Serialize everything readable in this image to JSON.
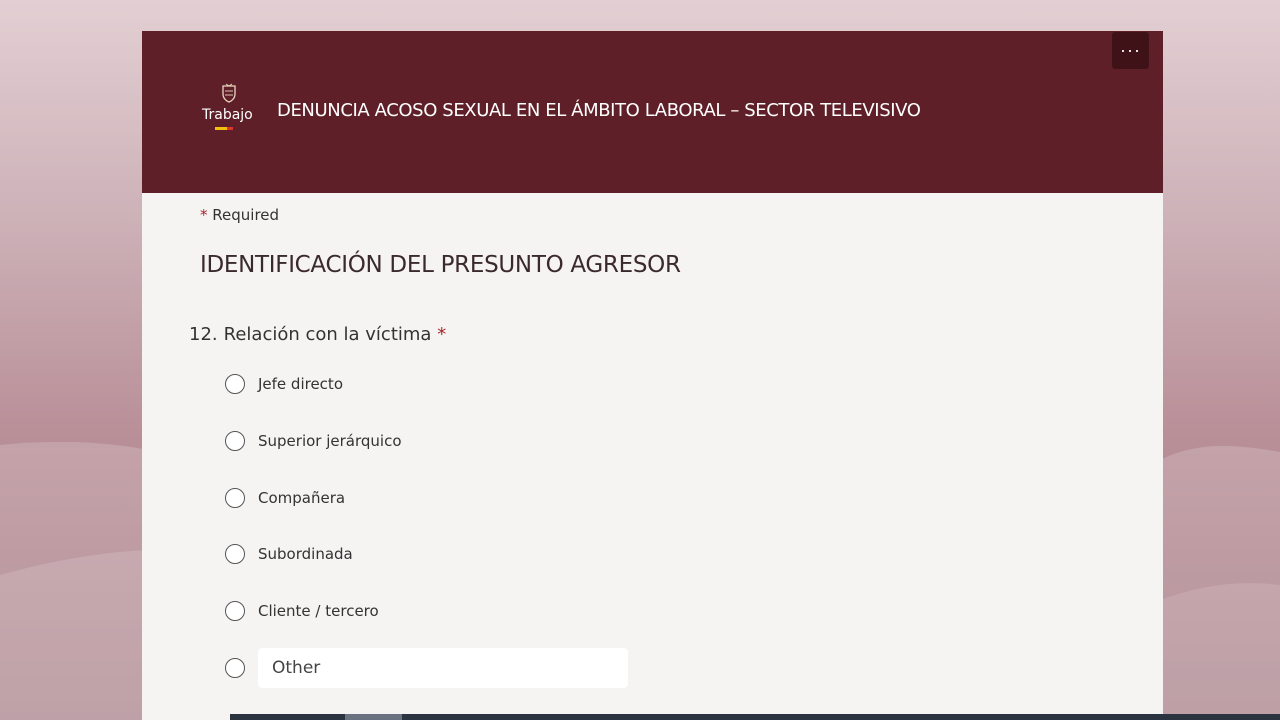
{
  "header": {
    "logo_text": "Trabajo",
    "form_title": "DENUNCIA ACOSO SEXUAL EN EL ÁMBITO LABORAL – SECTOR TELEVISIVO",
    "more_label": "···"
  },
  "form": {
    "required_marker": "*",
    "required_label": "Required",
    "section_title": "IDENTIFICACIÓN DEL PRESUNTO AGRESOR",
    "question": {
      "number": "12.",
      "text": "Relación con la víctima",
      "required_marker": "*",
      "options": [
        {
          "label": "Jefe directo"
        },
        {
          "label": "Superior jerárquico"
        },
        {
          "label": "Compañera"
        },
        {
          "label": "Subordinada"
        },
        {
          "label": "Cliente / tercero"
        }
      ],
      "other_placeholder": "Other"
    }
  },
  "colors": {
    "header_bg": "#5f1f28",
    "accent_required": "#a4262c",
    "card_bg": "#f6f3f3"
  },
  "icons": {
    "more": "more-horizontal-icon",
    "logo_seal": "coat-of-arms-icon"
  }
}
